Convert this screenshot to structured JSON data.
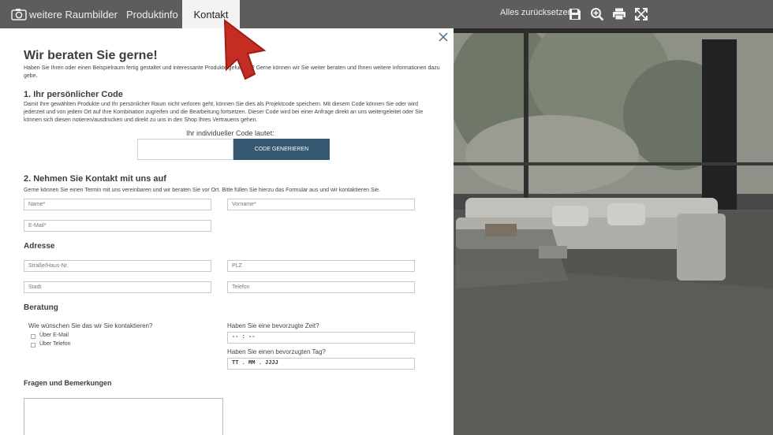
{
  "toolbar": {
    "tabs": [
      {
        "label": "weitere Raumbilder",
        "icon": "camera-icon"
      },
      {
        "label": "Produktinfo"
      },
      {
        "label": "Kontakt"
      }
    ],
    "reset_label": "Alles zurücksetzen",
    "icons": [
      "save-icon",
      "zoom-in-icon",
      "print-icon",
      "fullscreen-icon"
    ]
  },
  "panel": {
    "title": "Wir beraten Sie gerne!",
    "intro": "Haben Sie Ihren oder einen Beispielraum fertig gestaltet und interessante Produkte gefunden? Gerne können wir Sie weiter beraten und Ihnen weitere Informationen dazu gebe.",
    "section1": {
      "heading": "1. Ihr persönlicher Code",
      "text": "Damit Ihre gewählten Produkte und Ihr persönlicher Raum nicht verloren geht, können Sie dies als Projektcode speichern. Mit diesem Code können Sie oder wird jederzeit und von jedem Ort auf Ihre Kombination zugreifen und die Bearbeitung fortsetzen. Dieser Code wird bei einer Anfrage direkt an uns weitergeleitet oder Sie können sich diesen notieren/ausdrucken und direkt zu uns in den Shop Ihres Vertrauens gehen.",
      "code_label": "Ihr individueller Code lautet:",
      "code_value": "",
      "button": "CODE GENERIEREN"
    },
    "section2": {
      "heading": "2. Nehmen Sie Kontakt mit uns auf",
      "text": "Gerne können Sie einen Termin mit uns vereinbaren und wir beraten Sie vor Ort. Bitte füllen Sie hierzu das Formular aus und wir kontaktieren Sie.",
      "name_ph": "Name*",
      "vorname_ph": "Vorname*",
      "email_ph": "E-Mail*",
      "address_heading": "Adresse",
      "street_ph": "Straße/Haus-Nr.",
      "plz_ph": "PLZ",
      "city_ph": "Stadt",
      "phone_ph": "Telefon",
      "beratung_heading": "Beratung",
      "contact_question": "Wie wünschen Sie das wir Sie kontaktieren?",
      "options": [
        "Über E-Mail",
        "Über Telefon"
      ],
      "time_question": "Haben Sie eine bevorzugte Zeit?",
      "time_value": "-- : --",
      "day_question": "Haben Sie einen bevorzugten Tag?",
      "day_value": "TT . MM . JJJJ",
      "remarks_heading": "Fragen und Bemerkungen"
    }
  }
}
